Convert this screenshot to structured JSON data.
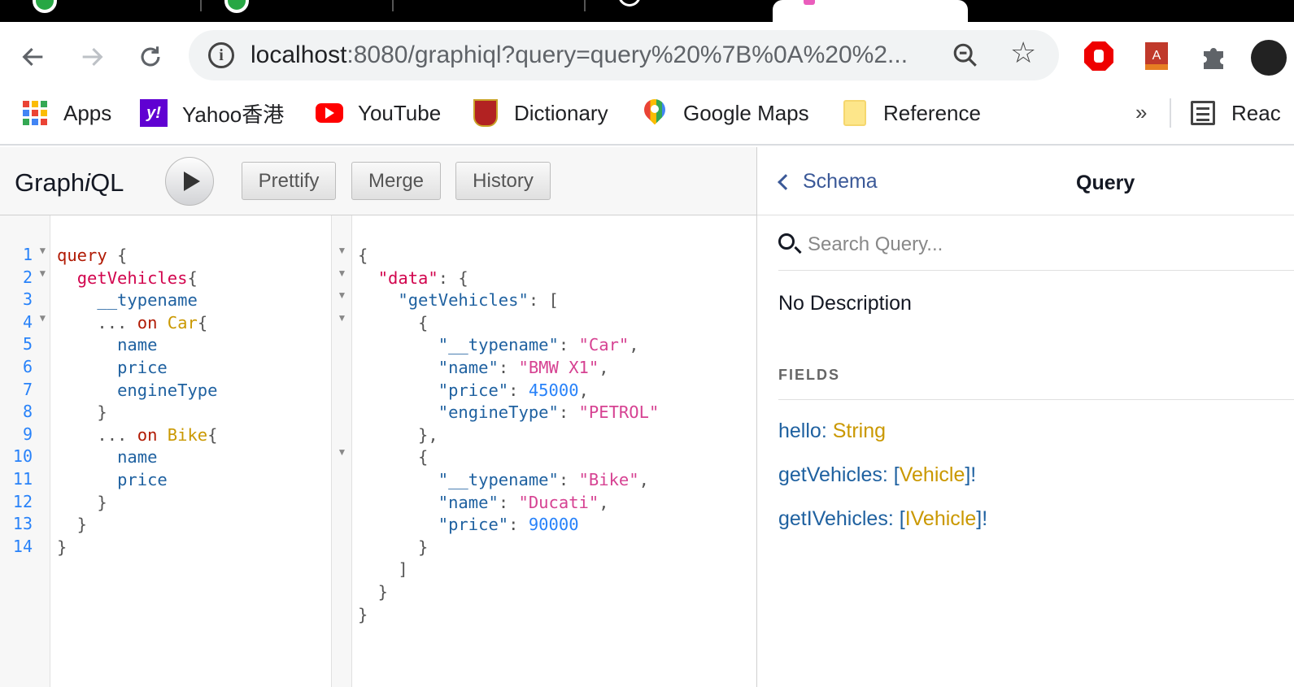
{
  "browser": {
    "url_host": "localhost",
    "url_rest": ":8080/graphiql?query=query%20%7B%0A%20%2...",
    "bookmarks": [
      {
        "label": "Apps",
        "icon": "apps-grid-icon"
      },
      {
        "label": "Yahoo香港",
        "icon": "yahoo-icon"
      },
      {
        "label": "YouTube",
        "icon": "youtube-icon"
      },
      {
        "label": "Dictionary",
        "icon": "dictionary-icon"
      },
      {
        "label": "Google Maps",
        "icon": "google-maps-icon"
      },
      {
        "label": "Reference",
        "icon": "folder-icon"
      }
    ],
    "more_bookmarks": "»",
    "reading_list": "Reac"
  },
  "graphiql": {
    "title_pre": "Graph",
    "title_i": "i",
    "title_post": "QL",
    "buttons": {
      "prettify": "Prettify",
      "merge": "Merge",
      "history": "History"
    },
    "query_line_numbers": [
      "1",
      "2",
      "3",
      "4",
      "5",
      "6",
      "7",
      "8",
      "9",
      "10",
      "11",
      "12",
      "13",
      "14"
    ]
  },
  "docs": {
    "back_label": "Schema",
    "title": "Query",
    "search_placeholder": "Search Query...",
    "description": "No Description",
    "fields_label": "FIELDS",
    "fields": [
      {
        "name": "hello",
        "type": "String",
        "wrap_open": "",
        "wrap_close": ""
      },
      {
        "name": "getVehicles",
        "type": "Vehicle",
        "wrap_open": "[",
        "wrap_close": "]!"
      },
      {
        "name": "getIVehicles",
        "type": "IVehicle",
        "wrap_open": "[",
        "wrap_close": "]!"
      }
    ]
  },
  "colors": {
    "accent_blue": "#3b5998",
    "keyword": "#b11a04",
    "type": "#ca9800",
    "string": "#d64292",
    "number": "#2882f9"
  }
}
